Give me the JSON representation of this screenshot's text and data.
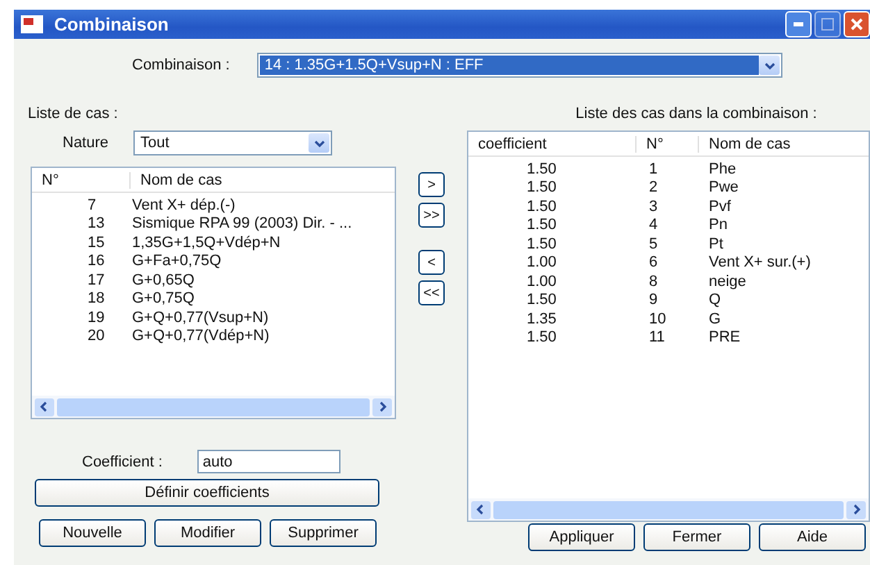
{
  "window": {
    "title": "Combinaison"
  },
  "combinaison": {
    "label": "Combinaison :",
    "value": "14 : 1.35G+1.5Q+Vsup+N : EFF"
  },
  "case_list": {
    "label": "Liste de cas :",
    "filter": {
      "label": "Nature",
      "value": "Tout"
    },
    "columns": [
      "N°",
      "Nom de cas"
    ],
    "rows": [
      {
        "number": "7",
        "name": "Vent X+  dép.(-)"
      },
      {
        "number": "13",
        "name": "Sismique RPA 99 (2003) Dir. - ..."
      },
      {
        "number": "15",
        "name": "1,35G+1,5Q+Vdép+N"
      },
      {
        "number": "16",
        "name": "G+Fa+0,75Q"
      },
      {
        "number": "17",
        "name": "G+0,65Q"
      },
      {
        "number": "18",
        "name": "G+0,75Q"
      },
      {
        "number": "19",
        "name": "G+Q+0,77(Vsup+N)"
      },
      {
        "number": "20",
        "name": "G+Q+0,77(Vdép+N)"
      }
    ]
  },
  "transfer_buttons": [
    ">",
    ">>",
    "<",
    "<<"
  ],
  "coefficient": {
    "label": "Coefficient :",
    "value": "auto"
  },
  "define_button": "Définir coefficients",
  "left_buttons": [
    "Nouvelle",
    "Modifier",
    "Supprimer"
  ],
  "combination_list": {
    "label": "Liste des cas dans la combinaison :",
    "columns": [
      "coefficient",
      "N°",
      "Nom de cas"
    ],
    "rows": [
      {
        "coefficient": "1.50",
        "number": "1",
        "name": "Phe"
      },
      {
        "coefficient": "1.50",
        "number": "2",
        "name": "Pwe"
      },
      {
        "coefficient": "1.50",
        "number": "3",
        "name": "Pvf"
      },
      {
        "coefficient": "1.50",
        "number": "4",
        "name": "Pn"
      },
      {
        "coefficient": "1.50",
        "number": "5",
        "name": "Pt"
      },
      {
        "coefficient": "1.00",
        "number": "6",
        "name": "Vent X+  sur.(+)"
      },
      {
        "coefficient": "1.00",
        "number": "8",
        "name": "neige"
      },
      {
        "coefficient": "1.50",
        "number": "9",
        "name": "Q"
      },
      {
        "coefficient": "1.35",
        "number": "10",
        "name": "G"
      },
      {
        "coefficient": "1.50",
        "number": "11",
        "name": "PRE"
      }
    ]
  },
  "right_buttons": [
    "Appliquer",
    "Fermer",
    "Aide"
  ]
}
